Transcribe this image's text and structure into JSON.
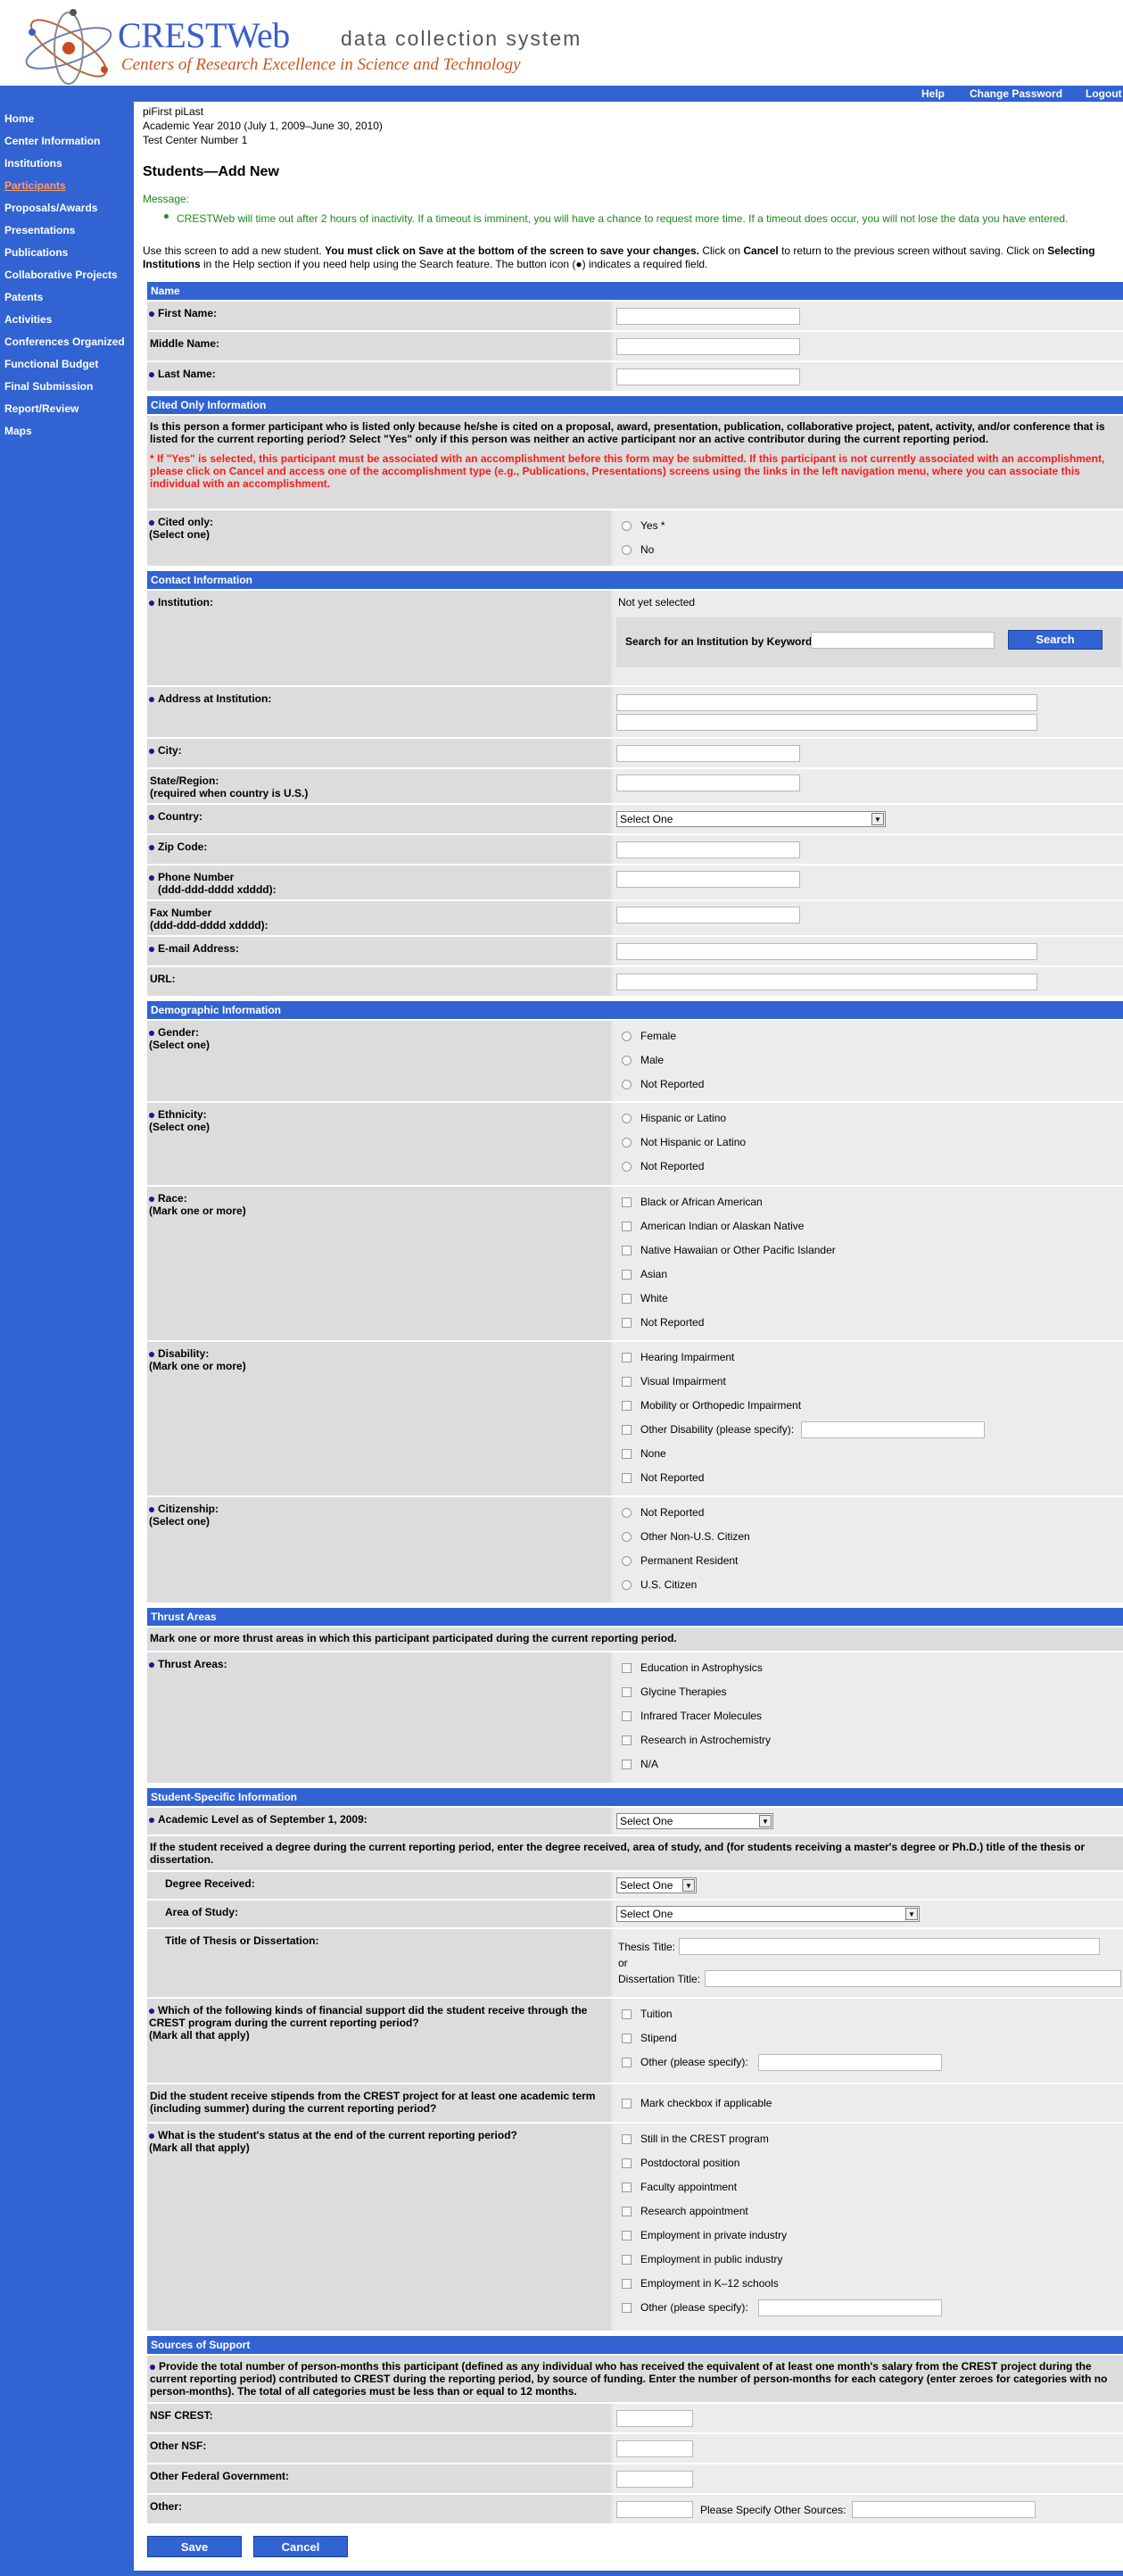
{
  "header": {
    "brand": "CRESTWeb",
    "brand_sub": "data collection system",
    "tagline": "Centers of Research Excellence in Science and Technology",
    "top_links": [
      "Help",
      "Change Password",
      "Logout"
    ]
  },
  "sidebar": {
    "items": [
      "Home",
      "Center Information",
      "Institutions",
      "Participants",
      "Proposals/Awards",
      "Presentations",
      "Publications",
      "Collaborative Projects",
      "Patents",
      "Activities",
      "Conferences Organized",
      "Functional Budget",
      "Final Submission",
      "Report/Review",
      "Maps"
    ],
    "active": "Participants"
  },
  "context": {
    "user": "piFirst piLast",
    "year": "Academic Year 2010 (July 1, 2009–June 30, 2010)",
    "center": "Test Center Number 1"
  },
  "page_title": "Students—Add New",
  "message": {
    "label": "Message:",
    "text": "CRESTWeb will time out after 2 hours of inactivity. If a timeout is imminent, you will have a chance to request more time. If a timeout does occur, you will not lose the data you have entered."
  },
  "intro": {
    "p1": "Use this screen to add a new student. ",
    "p2": "You must click on Save at the bottom of the screen to save your changes.",
    "p3": " Click on ",
    "p4": "Cancel",
    "p5": " to return to the previous screen without saving. Click on ",
    "p6": "Selecting Institutions",
    "p7": " in the Help section if you need help using the Search feature. The button icon (●) indicates a required field."
  },
  "sections": {
    "name": "Name",
    "cited": "Cited Only Information",
    "contact": "Contact Information",
    "demo": "Demographic Information",
    "thrust": "Thrust Areas",
    "student": "Student-Specific Information",
    "support": "Sources of Support"
  },
  "name": {
    "first": "First Name:",
    "middle": "Middle Name:",
    "last": "Last Name:"
  },
  "cited": {
    "q": "Is this person a former participant who is listed only because he/she is cited on a proposal, award, presentation, publication, collaborative project, patent, activity, and/or conference that is listed for the current reporting period? Select \"Yes\" only if this person was neither an active participant nor an active contributor during the current reporting period.",
    "warn": "* If \"Yes\" is selected, this participant must be associated with an accomplishment before this form may be submitted. If this participant is not currently associated with an accomplishment, please click on Cancel and access one of the accomplishment type (e.g., Publications, Presentations) screens using the links in the left navigation menu, where you can associate this individual with an accomplishment.",
    "label1": "Cited only:",
    "label2": "(Select one)",
    "yes": "Yes *",
    "no": "No"
  },
  "contact": {
    "institution": "Institution:",
    "not_selected": "Not yet selected",
    "search_label": "Search for an Institution by Keyword:",
    "search_btn": "Search",
    "address": "Address at Institution:",
    "city": "City:",
    "state1": "State/Region:",
    "state2": "(required when country is U.S.)",
    "country": "Country:",
    "country_sel": "Select One",
    "zip": "Zip Code:",
    "phone1": "Phone Number",
    "phone2": "(ddd-ddd-dddd xdddd):",
    "fax1": "Fax Number",
    "fax2": "(ddd-ddd-dddd xdddd):",
    "email": "E-mail Address:",
    "url": "URL:"
  },
  "demo": {
    "gender": {
      "l1": "Gender:",
      "l2": "(Select one)",
      "opts": [
        "Female",
        "Male",
        "Not Reported"
      ]
    },
    "eth": {
      "l1": "Ethnicity:",
      "l2": "(Select one)",
      "opts": [
        "Hispanic or Latino",
        "Not Hispanic or Latino",
        "Not Reported"
      ]
    },
    "race": {
      "l1": "Race:",
      "l2": "(Mark one or more)",
      "opts": [
        "Black or African American",
        "American Indian or Alaskan Native",
        "Native Hawaiian or Other Pacific Islander",
        "Asian",
        "White",
        "Not Reported"
      ]
    },
    "dis": {
      "l1": "Disability:",
      "l2": "(Mark one or more)",
      "opts": [
        "Hearing Impairment",
        "Visual Impairment",
        "Mobility or Orthopedic Impairment",
        "Other Disability (please specify):",
        "None",
        "Not Reported"
      ]
    },
    "cit": {
      "l1": "Citizenship:",
      "l2": "(Select one)",
      "opts": [
        "Not Reported",
        "Other Non-U.S. Citizen",
        "Permanent Resident",
        "U.S. Citizen"
      ]
    }
  },
  "thrust": {
    "note": "Mark one or more thrust areas in which this participant participated during the current reporting period.",
    "label": "Thrust Areas:",
    "opts": [
      "Education in Astrophysics",
      "Glycine Therapies",
      "Infrared Tracer Molecules",
      "Research in Astrochemistry",
      "N/A"
    ]
  },
  "student": {
    "level": "Academic Level as of September 1, 2009:",
    "level_sel": "Select One",
    "degree_note": "If the student received a degree during the current reporting period, enter the degree received, area of study, and (for students receiving a master's degree or Ph.D.) title of the thesis or dissertation.",
    "degree": "Degree Received:",
    "degree_sel": "Select One",
    "area": "Area of Study:",
    "area_sel": "Select One",
    "title": "Title of Thesis or Dissertation:",
    "thesis": "Thesis Title:",
    "or": "or",
    "diss": "Dissertation Title:",
    "fin1": "Which of the following kinds of financial support did the student receive through the",
    "fin2": "CREST program during the current reporting period?",
    "fin3": "(Mark all that apply)",
    "fin_opts": [
      "Tuition",
      "Stipend",
      "Other (please specify):"
    ],
    "stip1": "Did the student receive stipends from the CREST project for at least one academic term",
    "stip2": "(including summer) during the current reporting period?",
    "stip_opt": "Mark checkbox if applicable",
    "stat1": "What is the student's status at the end of the current reporting period?",
    "stat2": "(Mark all that apply)",
    "stat_opts": [
      "Still in the CREST program",
      "Postdoctoral position",
      "Faculty appointment",
      "Research appointment",
      "Employment in private industry",
      "Employment in public industry",
      "Employment in K–12 schools",
      "Other (please specify):"
    ]
  },
  "support": {
    "note": "Provide the total number of person-months this participant (defined as any individual who has received the equivalent of at least one month's salary from the CREST project during the current reporting period) contributed to CREST during the reporting period, by source of funding. Enter the number of person-months for each category (enter zeroes for categories with no person-months). The total of all categories must be less than or equal to 12 months.",
    "nsf_crest": "NSF CREST:",
    "other_nsf": "Other NSF:",
    "other_fed": "Other Federal Government:",
    "other": "Other:",
    "specify": "Please Specify Other Sources:"
  },
  "buttons": {
    "save": "Save",
    "cancel": "Cancel"
  }
}
